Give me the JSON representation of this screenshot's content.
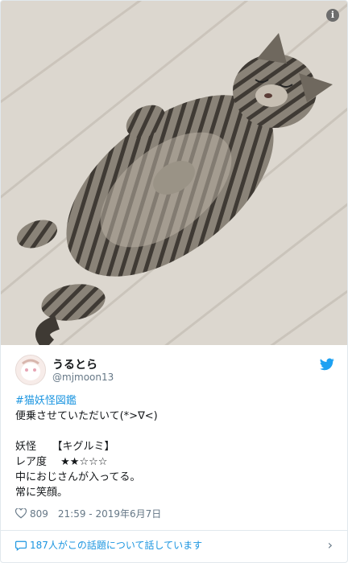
{
  "photo": {
    "alt_icon": "info-icon"
  },
  "author": {
    "display_name": "うるとら",
    "handle": "@mjmoon13"
  },
  "tweet": {
    "lines": [
      {
        "text": "#猫妖怪図鑑",
        "kind": "hashtag"
      },
      {
        "text": "便乗させていただいて(*>∇<)",
        "kind": "text"
      },
      {
        "text": "",
        "kind": "text"
      },
      {
        "text": "妖怪　　【キグルミ】",
        "kind": "text"
      },
      {
        "text": "レア度　 ★★☆☆☆",
        "kind": "text"
      },
      {
        "text": "中におじさんが入ってる。",
        "kind": "text"
      },
      {
        "text": "常に笑顔。",
        "kind": "text"
      }
    ]
  },
  "meta": {
    "like_count": "809",
    "timestamp": "21:59 - 2019年6月7日"
  },
  "footer": {
    "conversation_text": "187人がこの話題について話しています"
  },
  "colors": {
    "link": "#1b95e0",
    "muted": "#657786",
    "twitter_blue": "#1da1f2"
  }
}
